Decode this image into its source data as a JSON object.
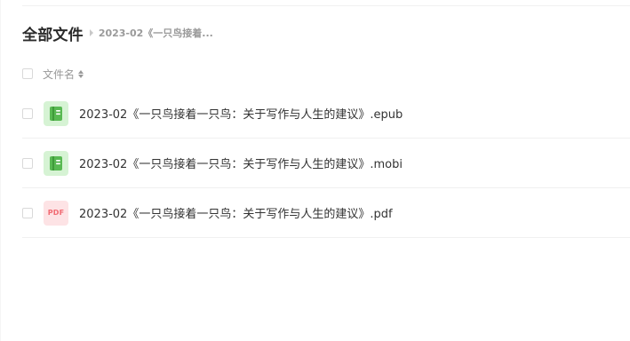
{
  "breadcrumb": {
    "root_label": "全部文件",
    "current_label": "2023-02《一只鸟接着..."
  },
  "list_header": {
    "column_name": "文件名"
  },
  "files": [
    {
      "name": "2023-02《一只鸟接着一只鸟：关于写作与人生的建议》.epub",
      "icon": "ebook-icon"
    },
    {
      "name": "2023-02《一只鸟接着一只鸟：关于写作与人生的建议》.mobi",
      "icon": "ebook-icon"
    },
    {
      "name": "2023-02《一只鸟接着一只鸟：关于写作与人生的建议》.pdf",
      "icon": "pdf-icon",
      "icon_text": "PDF"
    }
  ],
  "colors": {
    "ebook_icon_bg": "#d6f3d4",
    "ebook_icon_fg": "#58b952",
    "pdf_icon_bg": "#fde3e5",
    "pdf_icon_fg": "#f16a72"
  }
}
